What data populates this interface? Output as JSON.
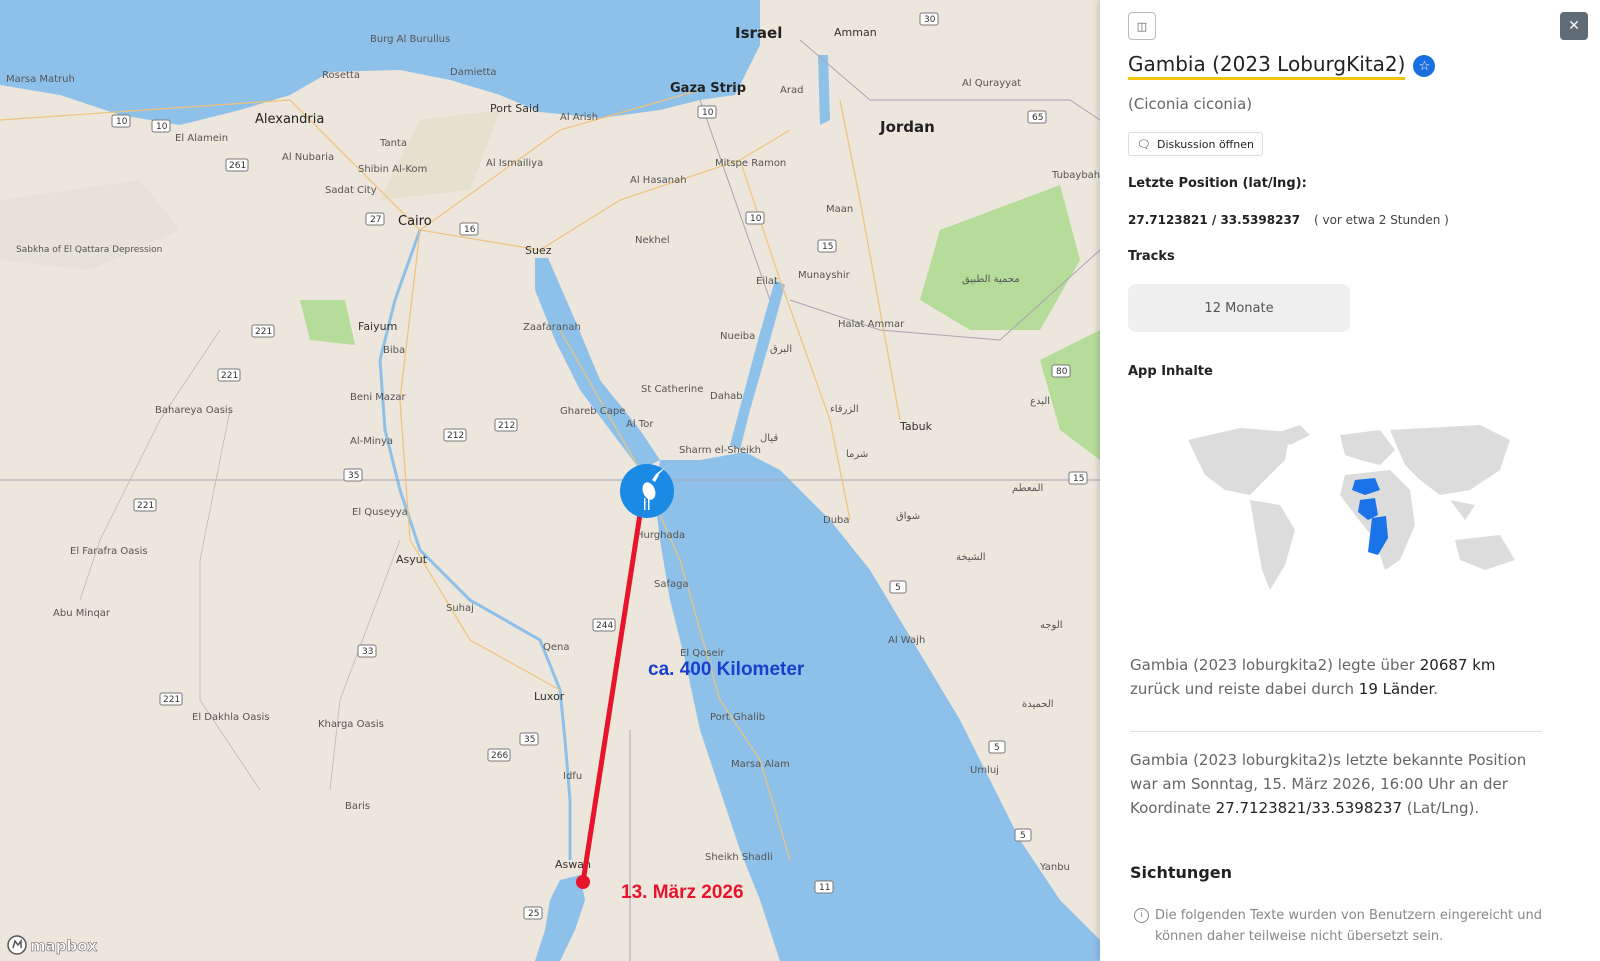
{
  "map": {
    "countries": [
      "Israel",
      "Jordan",
      "Gaza Strip"
    ],
    "cities": [
      {
        "name": "Alexandria"
      },
      {
        "name": "Cairo"
      },
      {
        "name": "Port Said"
      },
      {
        "name": "Suez"
      },
      {
        "name": "Faiyum"
      },
      {
        "name": "Asyut"
      },
      {
        "name": "Luxor"
      },
      {
        "name": "Aswan"
      },
      {
        "name": "Hurghada"
      },
      {
        "name": "Tabuk"
      },
      {
        "name": "Amman"
      },
      {
        "name": "Eilat"
      },
      {
        "name": "Arad"
      },
      {
        "name": "Marsa Matruh"
      },
      {
        "name": "Burg Al Burullus"
      },
      {
        "name": "Rosetta"
      },
      {
        "name": "Damietta"
      },
      {
        "name": "Al Arish"
      },
      {
        "name": "El Alamein"
      },
      {
        "name": "Tanta"
      },
      {
        "name": "Al Nubaria"
      },
      {
        "name": "Shibin Al-Kom"
      },
      {
        "name": "Sadat City"
      },
      {
        "name": "Al Ismailiya"
      },
      {
        "name": "Al Hasanah"
      },
      {
        "name": "Mitspe Ramon"
      },
      {
        "name": "Nekhel"
      },
      {
        "name": "Maan"
      },
      {
        "name": "Munayshir"
      },
      {
        "name": "Zaafaranah"
      },
      {
        "name": "Biba"
      },
      {
        "name": "Nueiba"
      },
      {
        "name": "Halat Ammar"
      },
      {
        "name": "St Catherine"
      },
      {
        "name": "Dahab"
      },
      {
        "name": "Beni Mazar"
      },
      {
        "name": "Ghareb Cape"
      },
      {
        "name": "Al Tor"
      },
      {
        "name": "Sharm el-Sheikh"
      },
      {
        "name": "Al-Minya"
      },
      {
        "name": "El Quseyya"
      },
      {
        "name": "Duba"
      },
      {
        "name": "Safaga"
      },
      {
        "name": "Suhaj"
      },
      {
        "name": "Qena"
      },
      {
        "name": "El Qoseir"
      },
      {
        "name": "Al Wajh"
      },
      {
        "name": "Port Ghalib"
      },
      {
        "name": "Marsa Alam"
      },
      {
        "name": "Umluj"
      },
      {
        "name": "Idfu"
      },
      {
        "name": "Sheikh Shadli"
      },
      {
        "name": "Yanbu"
      },
      {
        "name": "Kharga Oasis"
      },
      {
        "name": "El Dakhla Oasis"
      },
      {
        "name": "Baris"
      },
      {
        "name": "Bahareya Oasis"
      },
      {
        "name": "El Farafra Oasis"
      },
      {
        "name": "Abu Minqar"
      },
      {
        "name": "Sabkha of El Qattara Depression"
      },
      {
        "name": "Al Qurayyat"
      },
      {
        "name": "Tubaybah"
      }
    ],
    "arabic_labels": [
      "محمية الطبيق",
      "البرق",
      "قيال",
      "الزرقاء",
      "شرما",
      "المعطم",
      "شواق",
      "الشيخة",
      "الوجه",
      "الحميدة",
      "البدع"
    ],
    "road_numbers": [
      "10",
      "10",
      "261",
      "27",
      "16",
      "221",
      "221",
      "221",
      "212",
      "212",
      "35",
      "244",
      "33",
      "221",
      "266",
      "35",
      "25",
      "11",
      "10",
      "10",
      "15",
      "5",
      "5",
      "5",
      "15",
      "65",
      "30",
      "80"
    ],
    "distance_label": "ca. 400 Kilometer",
    "date_label": "13. März 2026",
    "attribution": "mapbox",
    "line_color": "#e8142c",
    "marker_color": "#1a8ae5",
    "distance_color": "#1a3fcf",
    "date_color": "#e8142c"
  },
  "panel": {
    "bird_name": "Gambia (2023 LoburgKita2)",
    "species": "(Ciconia ciconia)",
    "discussion_button": "Diskussion öffnen",
    "last_position_label": "Letzte Position (lat/lng):",
    "last_position_value": "27.7123821 / 33.5398237",
    "last_position_ago": "( vor etwa 2 Stunden )",
    "tracks_label": "Tracks",
    "tracks_button": "12 Monate",
    "app_content_label": "App Inhalte",
    "summary1_prefix": "Gambia (2023 loburgkita2) legte über ",
    "summary1_km": "20687 km",
    "summary1_mid": " zurück und reiste dabei durch ",
    "summary1_countries": "19 Länder",
    "summary1_end": ".",
    "summary2_prefix": "Gambia (2023 loburgkita2)s letzte bekannte Position war am Sonntag, 15. März 2026, 16:00 Uhr an der Koordinate ",
    "summary2_coords": "27.7123821/33.5398237",
    "summary2_end": " (Lat/Lng).",
    "sightings_title": "Sichtungen",
    "sightings_note": "Die folgenden Texte wurden von Benutzern eingereicht und können daher teilweise nicht übersetzt sein.",
    "highlight_color": "#1a73e8"
  }
}
